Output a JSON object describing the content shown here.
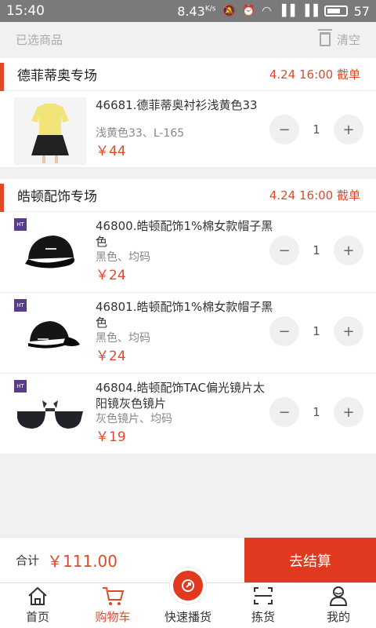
{
  "status": {
    "time": "15:40",
    "speed": "8.43",
    "speed_unit": "K/s",
    "battery": "57"
  },
  "header": {
    "selected_label": "已选商品",
    "clear_label": "清空"
  },
  "sections": [
    {
      "title": "德菲蒂奥专场",
      "cutoff": "4.24  16:00  截单",
      "items": [
        {
          "name": "46681.德菲蒂奥衬衫浅黄色33",
          "spec": "浅黄色33、L-165",
          "price": "￥44",
          "qty": "1"
        }
      ]
    },
    {
      "title": "皓顿配饰专场",
      "cutoff": "4.24  16:00  截单",
      "items": [
        {
          "name": "46800.皓顿配饰1%棉女款帽子黑色",
          "spec": "黑色、均码",
          "price": "￥24",
          "qty": "1"
        },
        {
          "name": "46801.皓顿配饰1%棉女款帽子黑色",
          "spec": "黑色、均码",
          "price": "￥24",
          "qty": "1"
        },
        {
          "name": "46804.皓顿配饰TAC偏光镜片太阳镜灰色镜片",
          "spec": "灰色镜片、均码",
          "price": "￥19",
          "qty": "1"
        }
      ]
    }
  ],
  "stepper": {
    "minus": "−",
    "plus": "+"
  },
  "brand_tag": "HT",
  "footer": {
    "total_label": "合计",
    "total_value": "￥111.00",
    "checkout_label": "去结算"
  },
  "tabs": [
    {
      "label": "首页",
      "icon": "home-icon"
    },
    {
      "label": "购物车",
      "icon": "cart-icon"
    },
    {
      "label": "快速播货",
      "icon": "share-icon"
    },
    {
      "label": "拣货",
      "icon": "scan-icon"
    },
    {
      "label": "我的",
      "icon": "user-icon"
    }
  ],
  "colors": {
    "accent": "#e0391f",
    "price": "#e04a2a",
    "status_bar": "#7a7a7a"
  }
}
